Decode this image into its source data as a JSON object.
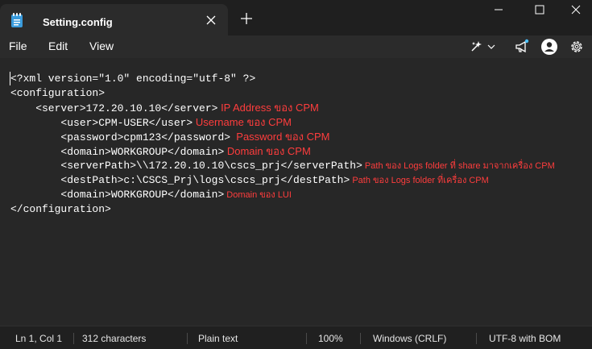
{
  "tab": {
    "title": "Setting.config",
    "app_icon": "notepad-icon",
    "close_icon": "close-icon"
  },
  "new_tab_icon": "plus-icon",
  "window_controls": [
    "minimize-icon",
    "maximize-icon",
    "close-icon"
  ],
  "menu": {
    "file": "File",
    "edit": "Edit",
    "view": "View"
  },
  "toolbar_icons": [
    "copilot-icon",
    "chevron-down-icon",
    "megaphone-icon",
    "account-icon",
    "gear-icon"
  ],
  "editor": {
    "lines": [
      {
        "code": "<?xml version=\"1.0\" encoding=\"utf-8\" ?>",
        "annotation": ""
      },
      {
        "code": "<configuration>",
        "annotation": ""
      },
      {
        "code": "    <server>172.20.10.10</server>",
        "annotation": " IP Address ของ CPM"
      },
      {
        "code": "        <user>CPM-USER</user>",
        "annotation": " Username ของ CPM"
      },
      {
        "code": "        <password>cpm123</password>",
        "annotation": "  Password ของ CPM"
      },
      {
        "code": "        <domain>WORKGROUP</domain>",
        "annotation": " Domain ของ CPM"
      },
      {
        "code": "        <serverPath>\\\\172.20.10.10\\cscs_prj</serverPath>",
        "annotation": " Path ของ Logs folder ที่ share มาจากเครื่อง CPM"
      },
      {
        "code": "        <destPath>c:\\CSCS_Prj\\logs\\cscs_prj</destPath>",
        "annotation": " Path ของ Logs folder ที่เครื่อง CPM"
      },
      {
        "code": "        <domain>WORKGROUP</domain>",
        "annotation": " Domain ของ LUI"
      },
      {
        "code": "</configuration>",
        "annotation": ""
      }
    ]
  },
  "status": {
    "position": "Ln 1, Col 1",
    "characters": "312 characters",
    "format": "Plain text",
    "zoom": "100%",
    "line_ending": "Windows (CRLF)",
    "encoding": "UTF-8 with BOM"
  },
  "colors": {
    "annotation": "#ff3d3d",
    "background": "#272727",
    "titlebar": "#1f1f1f"
  }
}
